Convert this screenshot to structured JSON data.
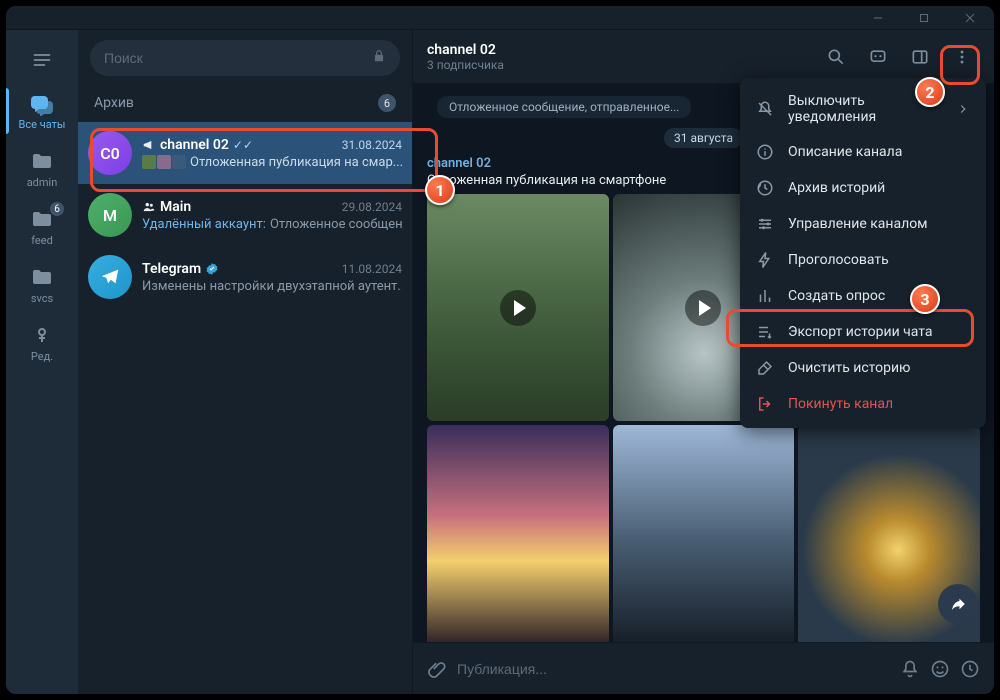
{
  "window": {
    "minimize": "—",
    "maximize": "▢",
    "close": "✕"
  },
  "search": {
    "placeholder": "Поиск"
  },
  "rail": {
    "all": "Все чаты",
    "f1": "admin",
    "f2": "feed",
    "f2_badge": "6",
    "f3": "svcs",
    "edit": "Ред."
  },
  "archive": {
    "label": "Архив",
    "count": "6"
  },
  "chats": [
    {
      "avatar_text": "C0",
      "icon": "megaphone",
      "title": "channel 02",
      "date": "31.08.2024",
      "check": "✓✓",
      "preview": "Отложенная публикация на смар..."
    },
    {
      "avatar_text": "M",
      "icon": "group",
      "title": "Main",
      "date": "29.08.2024",
      "sender": "Удалённый аккаунт:",
      "preview": " Отложенное сообщен..."
    },
    {
      "avatar_text": "",
      "icon": "telegram",
      "title": "Telegram",
      "date": "11.08.2024",
      "preview": "Изменены настройки двухэтапной аутент..."
    }
  ],
  "chat_header": {
    "title": "channel 02",
    "sub": "3 подписчика"
  },
  "chat_body": {
    "old_msg": "Отложенное сообщение, отправленное...",
    "date_chip": "31 августа",
    "post_channel": "channel 02",
    "post_caption": "Отложенная публикация на смартфоне"
  },
  "composer": {
    "placeholder": "Публикация..."
  },
  "menu": {
    "mute": "Выключить уведомления",
    "desc": "Описание канала",
    "stories": "Архив историй",
    "manage": "Управление каналом",
    "boost": "Проголосовать",
    "poll": "Создать опрос",
    "export": "Экспорт истории чата",
    "clear": "Очистить историю",
    "leave": "Покинуть канал"
  },
  "markers": {
    "n1": "1",
    "n2": "2",
    "n3": "3"
  }
}
